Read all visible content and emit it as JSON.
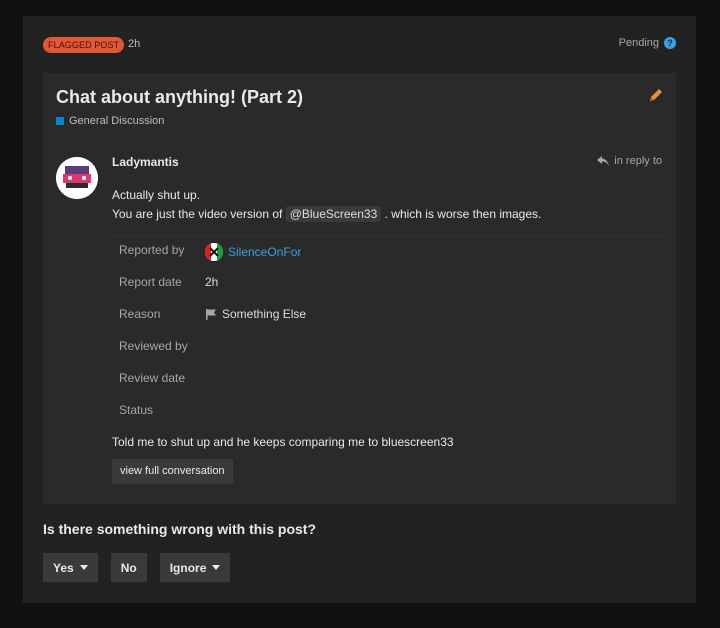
{
  "review": {
    "badge": "FLAGGED POST",
    "age": "2h",
    "status": "Pending",
    "help_icon": "question-circle-icon"
  },
  "topic": {
    "title": "Chat about anything! (Part 2)",
    "category": "General Discussion",
    "category_color": "#0088cc",
    "edit_icon": "pencil-icon"
  },
  "post": {
    "author": "Ladymantis",
    "reply_label": "in reply to",
    "line1": "Actually shut up.",
    "line2_before": "You are just the video version of",
    "mention": "@BlueScreen33",
    "line2_after": ". which is worse then images."
  },
  "details": {
    "reported_by_label": "Reported by",
    "reporter": "SilenceOnFor",
    "report_date_label": "Report date",
    "report_date": "2h",
    "reason_label": "Reason",
    "reason": "Something Else",
    "reviewed_by_label": "Reviewed by",
    "review_date_label": "Review date",
    "status_label": "Status"
  },
  "flag_message": "Told me to shut up and he keeps comparing me to bluescreen33",
  "conversation_button": "view full conversation",
  "question": "Is there something wrong with this post?",
  "actions": {
    "yes": "Yes",
    "no": "No",
    "ignore": "Ignore"
  },
  "colors": {
    "badge": "#e45735",
    "link": "#3aa1e6",
    "edit": "#e69138"
  }
}
